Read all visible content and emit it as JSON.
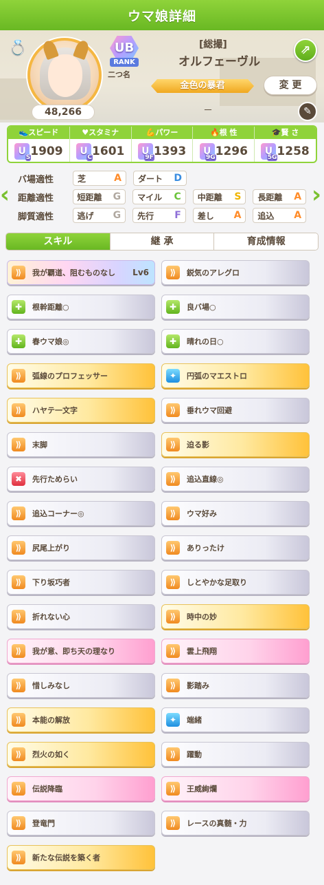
{
  "header": {
    "title": "ウマ娘詳細"
  },
  "profile": {
    "rank_letters": "UB",
    "rank_label": "RANK",
    "nickname": "二つ名",
    "epithet": "[総撮]",
    "name": "オルフェーヴル",
    "title": "金色の暴君",
    "change_label": "変 更",
    "fans": "48,266",
    "dash": "－"
  },
  "stats": [
    {
      "label": "スピード",
      "grade": "U",
      "sub": "S",
      "value": "1909",
      "icon": "shoe-icon"
    },
    {
      "label": "スタミナ",
      "grade": "U",
      "sub": "C",
      "value": "1601",
      "icon": "heart-icon"
    },
    {
      "label": "パワー",
      "grade": "U",
      "sub": "9F",
      "value": "1393",
      "icon": "arm-icon"
    },
    {
      "label": "根 性",
      "grade": "U",
      "sub": "9G",
      "value": "1296",
      "icon": "flame-icon"
    },
    {
      "label": "賢 さ",
      "grade": "U",
      "sub": "5G",
      "value": "1258",
      "icon": "cap-icon"
    }
  ],
  "aptitude": {
    "track_label": "バ場適性",
    "track": [
      {
        "name": "芝",
        "grade": "A"
      },
      {
        "name": "ダート",
        "grade": "D"
      }
    ],
    "distance_label": "距離適性",
    "distance": [
      {
        "name": "短距離",
        "grade": "G"
      },
      {
        "name": "マイル",
        "grade": "C"
      },
      {
        "name": "中距離",
        "grade": "S"
      },
      {
        "name": "長距離",
        "grade": "A"
      }
    ],
    "style_label": "脚質適性",
    "style": [
      {
        "name": "逃げ",
        "grade": "G"
      },
      {
        "name": "先行",
        "grade": "F"
      },
      {
        "name": "差し",
        "grade": "A"
      },
      {
        "name": "追込",
        "grade": "A"
      }
    ]
  },
  "tabs": [
    "スキル",
    "継 承",
    "育成情報"
  ],
  "skills": [
    {
      "name": "我が覇道、阻むものなし",
      "level": "Lv6",
      "type": "rainbow",
      "icon": "speed"
    },
    {
      "name": "鋭気のアレグロ",
      "level": "",
      "type": "normal",
      "icon": "speed"
    },
    {
      "name": "根幹距離○",
      "level": "",
      "type": "normal",
      "icon": "green"
    },
    {
      "name": "良バ場○",
      "level": "",
      "type": "normal",
      "icon": "green"
    },
    {
      "name": "春ウマ娘◎",
      "level": "",
      "type": "normal",
      "icon": "green"
    },
    {
      "name": "晴れの日○",
      "level": "",
      "type": "normal",
      "icon": "green"
    },
    {
      "name": "弧線のプロフェッサー",
      "level": "",
      "type": "gold",
      "icon": "speed"
    },
    {
      "name": "円弧のマエストロ",
      "level": "",
      "type": "gold",
      "icon": "blue"
    },
    {
      "name": "ハヤテ一文字",
      "level": "",
      "type": "gold",
      "icon": "speed"
    },
    {
      "name": "垂れウマ回避",
      "level": "",
      "type": "normal",
      "icon": "speed"
    },
    {
      "name": "末脚",
      "level": "",
      "type": "normal",
      "icon": "speed"
    },
    {
      "name": "迫る影",
      "level": "",
      "type": "gold",
      "icon": "speed"
    },
    {
      "name": "先行ためらい",
      "level": "",
      "type": "normal",
      "icon": "red"
    },
    {
      "name": "追込直線◎",
      "level": "",
      "type": "normal",
      "icon": "speed"
    },
    {
      "name": "追込コーナー◎",
      "level": "",
      "type": "normal",
      "icon": "speed"
    },
    {
      "name": "ウマ好み",
      "level": "",
      "type": "normal",
      "icon": "speed"
    },
    {
      "name": "尻尾上がり",
      "level": "",
      "type": "normal",
      "icon": "speed"
    },
    {
      "name": "ありったけ",
      "level": "",
      "type": "normal",
      "icon": "speed"
    },
    {
      "name": "下り坂巧者",
      "level": "",
      "type": "normal",
      "icon": "speed"
    },
    {
      "name": "しとやかな足取り",
      "level": "",
      "type": "normal",
      "icon": "speed"
    },
    {
      "name": "折れない心",
      "level": "",
      "type": "normal",
      "icon": "speed"
    },
    {
      "name": "時中の妙",
      "level": "",
      "type": "gold",
      "icon": "speed"
    },
    {
      "name": "我が意、即ち天の理なり",
      "level": "",
      "type": "pink",
      "icon": "speed"
    },
    {
      "name": "雲上飛翔",
      "level": "",
      "type": "pink",
      "icon": "speed"
    },
    {
      "name": "惜しみなし",
      "level": "",
      "type": "normal",
      "icon": "speed"
    },
    {
      "name": "影踏み",
      "level": "",
      "type": "normal",
      "icon": "speed"
    },
    {
      "name": "本能の解放",
      "level": "",
      "type": "gold",
      "icon": "speed"
    },
    {
      "name": "端緒",
      "level": "",
      "type": "normal",
      "icon": "blue"
    },
    {
      "name": "烈火の如く",
      "level": "",
      "type": "gold",
      "icon": "speed"
    },
    {
      "name": "躍動",
      "level": "",
      "type": "normal",
      "icon": "speed"
    },
    {
      "name": "伝説降臨",
      "level": "",
      "type": "pink",
      "icon": "speed"
    },
    {
      "name": "王威絢爛",
      "level": "",
      "type": "pink",
      "icon": "speed"
    },
    {
      "name": "登竜門",
      "level": "",
      "type": "normal",
      "icon": "speed"
    },
    {
      "name": "レースの真髄・力",
      "level": "",
      "type": "normal",
      "icon": "speed"
    },
    {
      "name": "新たな伝説を築く者",
      "level": "",
      "type": "gold",
      "icon": "speed"
    }
  ]
}
